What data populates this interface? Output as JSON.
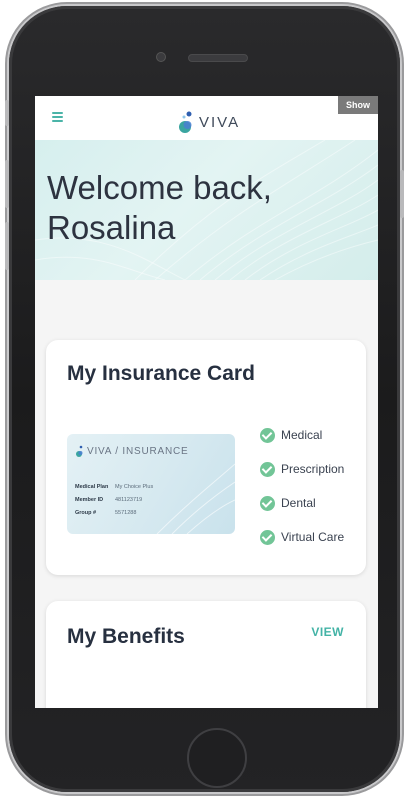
{
  "header": {
    "logo_text": "VIVA",
    "show_label": "Show"
  },
  "hero": {
    "line1": "Welcome back,",
    "line2": "Rosalina"
  },
  "insurance_card": {
    "title": "My Insurance Card",
    "card_logo_text": "VIVA / INSURANCE",
    "fields": [
      {
        "label": "Medical Plan",
        "value": "My Choice Plus"
      },
      {
        "label": "Member ID",
        "value": "481123719"
      },
      {
        "label": "Group #",
        "value": "5571288"
      }
    ],
    "benefits": [
      "Medical",
      "Prescription",
      "Dental",
      "Virtual Care"
    ]
  },
  "benefits_card": {
    "title": "My Benefits",
    "view_label": "VIEW"
  },
  "colors": {
    "accent": "#43b3a6",
    "check": "#72c597",
    "hero_bg": "#d6efee",
    "title_text": "#273040"
  }
}
